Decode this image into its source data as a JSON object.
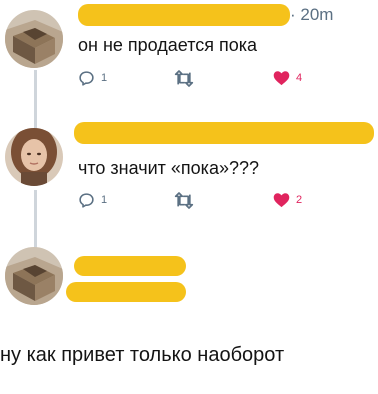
{
  "tweets": [
    {
      "time": "· 20m",
      "text": "он не продается пока",
      "reply_count": "1",
      "like_count": "4"
    },
    {
      "text": "что значит «пока»???",
      "reply_count": "1",
      "like_count": "2"
    },
    {}
  ],
  "caption": "ну как привет только наоборот",
  "colors": {
    "redaction": "#f5c21b",
    "like": "#e0245e",
    "muted": "#5b7083",
    "thread_line": "#cfd5db"
  },
  "icons": [
    "reply-icon",
    "retweet-icon",
    "heart-icon"
  ]
}
